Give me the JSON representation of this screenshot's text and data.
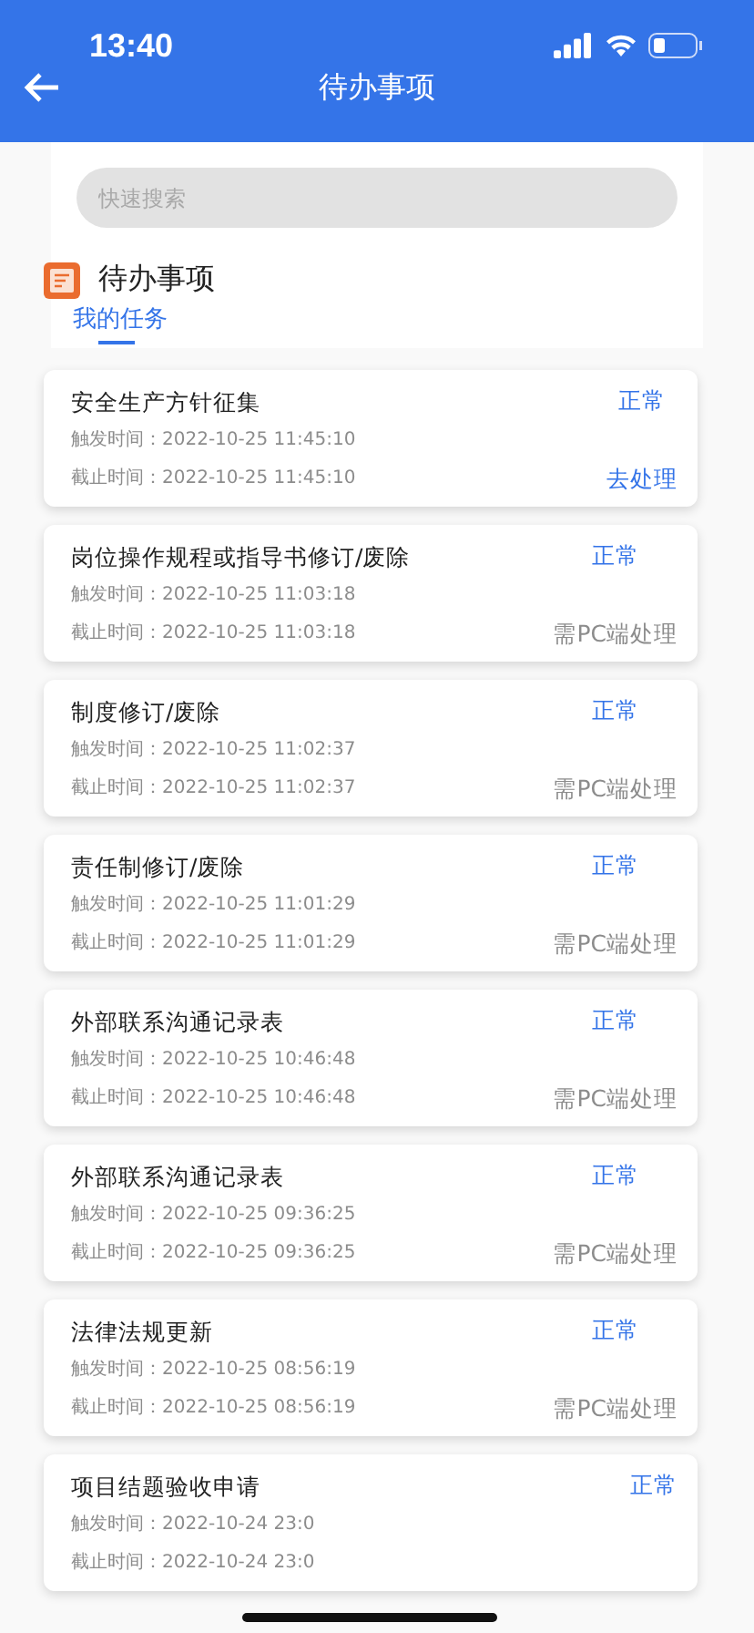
{
  "status_bar": {
    "time": "13:40"
  },
  "header": {
    "title": "待办事项"
  },
  "search": {
    "placeholder": "快速搜索"
  },
  "section": {
    "title": "待办事项"
  },
  "tabs": [
    {
      "label": "我的任务",
      "selected": true
    }
  ],
  "tasks": [
    {
      "title": "安全生产方针征集",
      "status": "正常",
      "trigger": "触发时间：2022-10-25 11:45:10",
      "deadline": "截止时间：2022-10-25 11:45:10",
      "action": {
        "kind": "go",
        "label": "去处理"
      }
    },
    {
      "title": "岗位操作规程或指导书修订/废除",
      "status": "正常",
      "trigger": "触发时间：2022-10-25 11:03:18",
      "deadline": "截止时间：2022-10-25 11:03:18",
      "action": {
        "kind": "pc",
        "label": "需PC端处理"
      }
    },
    {
      "title": "制度修订/废除",
      "status": "正常",
      "trigger": "触发时间：2022-10-25 11:02:37",
      "deadline": "截止时间：2022-10-25 11:02:37",
      "action": {
        "kind": "pc",
        "label": "需PC端处理"
      }
    },
    {
      "title": "责任制修订/废除",
      "status": "正常",
      "trigger": "触发时间：2022-10-25 11:01:29",
      "deadline": "截止时间：2022-10-25 11:01:29",
      "action": {
        "kind": "pc",
        "label": "需PC端处理"
      }
    },
    {
      "title": "外部联系沟通记录表",
      "status": "正常",
      "trigger": "触发时间：2022-10-25 10:46:48",
      "deadline": "截止时间：2022-10-25 10:46:48",
      "action": {
        "kind": "pc",
        "label": "需PC端处理"
      }
    },
    {
      "title": "外部联系沟通记录表",
      "status": "正常",
      "trigger": "触发时间：2022-10-25 09:36:25",
      "deadline": "截止时间：2022-10-25 09:36:25",
      "action": {
        "kind": "pc",
        "label": "需PC端处理"
      }
    },
    {
      "title": "法律法规更新",
      "status": "正常",
      "trigger": "触发时间：2022-10-25 08:56:19",
      "deadline": "截止时间：2022-10-25 08:56:19",
      "action": {
        "kind": "pc",
        "label": "需PC端处理"
      }
    },
    {
      "title": "项目结题验收申请",
      "status": "正常",
      "trigger": "触发时间：2022-10-24 23:0",
      "deadline": "截止时间：2022-10-24 23:0"
    }
  ]
}
